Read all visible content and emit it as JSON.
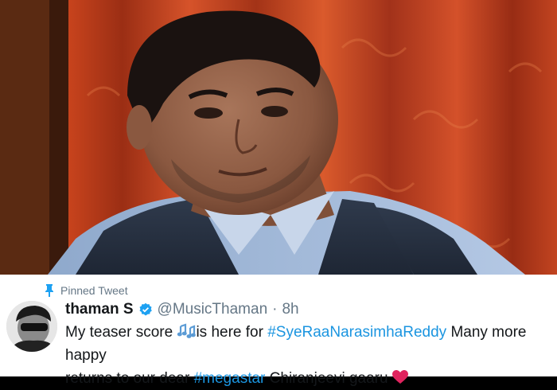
{
  "tweet": {
    "pinned_label": "Pinned Tweet",
    "name": "thaman S",
    "handle": "@MusicThaman",
    "separator": "·",
    "time": "8h",
    "text_1": "My teaser score",
    "text_2": "is here for",
    "hashtag_1": "#SyeRaaNarasimhaReddy",
    "text_3": "Many more happy",
    "text_4": "returns to our dear",
    "hashtag_2": "#megastar",
    "text_5": "Chiranjeevi gaaru",
    "icons": {
      "pin": "pin-icon",
      "verified": "verified-badge-icon",
      "music": "music-notes-emoji",
      "heart": "red-heart-emoji"
    },
    "colors": {
      "hashtag": "#1b95e0",
      "muted": "#657786",
      "verified": "#1da1f2",
      "heart": "#e0245e"
    }
  }
}
